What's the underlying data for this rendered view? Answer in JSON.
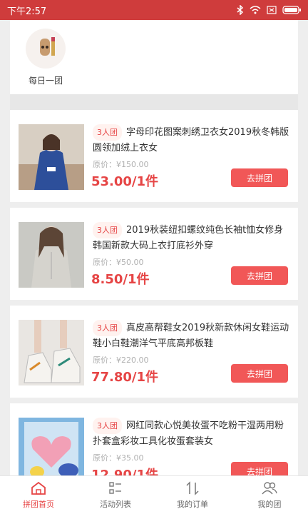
{
  "status": {
    "time": "下午2:57"
  },
  "category": {
    "label": "每日一团"
  },
  "items": [
    {
      "badge": "3人团",
      "title": "字母印花图案刺绣卫衣女2019秋冬韩版圆领加绒上衣女",
      "orig": "原价：¥150.00",
      "price": "53.00/1件",
      "button": "去拼团"
    },
    {
      "badge": "3人团",
      "title": "2019秋装纽扣螺纹纯色长袖t恤女修身韩国新款大码上衣打底衫外穿",
      "orig": "原价：¥50.00",
      "price": "8.50/1件",
      "button": "去拼团"
    },
    {
      "badge": "3人团",
      "title": "真皮高帮鞋女2019秋新款休闲女鞋运动鞋小白鞋潮洋气平底高邦板鞋",
      "orig": "原价：¥220.00",
      "price": "77.80/1件",
      "button": "去拼团"
    },
    {
      "badge": "3人团",
      "title": "网红同款心悦美妆蛋不吃粉干湿两用粉扑套盒彩妆工具化妆蛋套装女",
      "orig": "原价：¥35.00",
      "price": "12.90/1件",
      "button": "去拼团"
    }
  ],
  "tabs": [
    {
      "label": "拼团首页"
    },
    {
      "label": "活动列表"
    },
    {
      "label": "我的订单"
    },
    {
      "label": "我的团"
    }
  ]
}
